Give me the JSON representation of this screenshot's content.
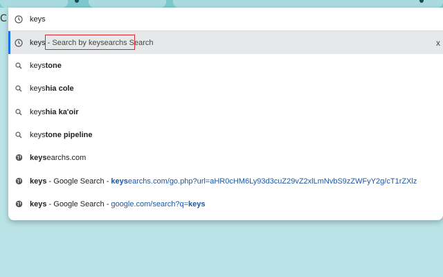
{
  "omnibox": {
    "input_value": "keys",
    "selected_keyword": "keys",
    "selected_separator": " - ",
    "selected_hint": "Search by keysearchs Search",
    "close_label": "x"
  },
  "suggestions": [
    {
      "icon": "search-icon",
      "match": "keys",
      "rest": "tone"
    },
    {
      "icon": "search-icon",
      "match": "keys",
      "rest": "hia cole"
    },
    {
      "icon": "search-icon",
      "match": "keys",
      "rest": "hia ka'oir"
    },
    {
      "icon": "search-icon",
      "match": "keys",
      "rest": "tone pipeline"
    },
    {
      "icon": "globe-icon",
      "match": "keys",
      "rest": "earchs.com"
    },
    {
      "icon": "globe-icon",
      "title": "keys",
      "sep": " - Google Search - ",
      "url_match": "keys",
      "url_rest": "earchs.com/go.php?url=aHR0cHM6Ly93d3cuZ29vZ2xlLmNvbS9zZWFyY2g/cT1rZXlz"
    },
    {
      "icon": "globe-icon",
      "title": "keys",
      "sep": " - Google Search - ",
      "url_rest": "google.com/search?q=",
      "url_match": "keys"
    }
  ],
  "reload_glyph": "C"
}
